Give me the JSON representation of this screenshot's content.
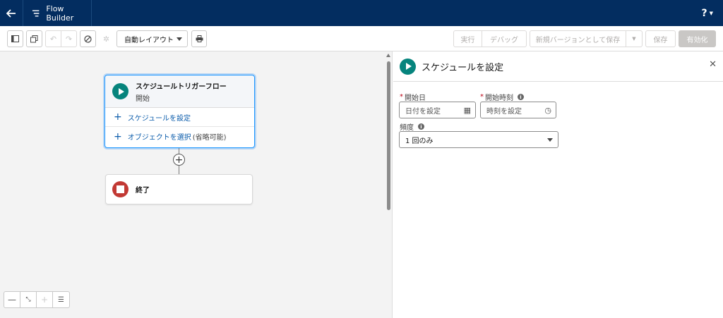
{
  "header": {
    "app_title": "Flow Builder",
    "help_label": "?"
  },
  "toolbar": {
    "layout_value": "自動レイアウト",
    "run_label": "実行",
    "debug_label": "デバッグ",
    "save_new_version_label": "新規バージョンとして保存",
    "save_label": "保存",
    "activate_label": "有効化"
  },
  "canvas": {
    "start": {
      "title": "スケジュールトリガーフロー",
      "subtitle": "開始",
      "set_schedule_label": "スケジュールを設定",
      "choose_object_label": "オブジェクトを選択",
      "optional_note": "(省略可能)"
    },
    "end_label": "終了"
  },
  "panel": {
    "title": "スケジュールを設定",
    "start_date": {
      "label": "開始日",
      "placeholder": "日付を設定"
    },
    "start_time": {
      "label": "開始時刻",
      "placeholder": "時刻を設定"
    },
    "frequency": {
      "label": "頻度",
      "value": "1 回のみ"
    }
  },
  "colors": {
    "header_bg": "#032d60",
    "start_icon": "#06847d",
    "end_icon": "#c23934",
    "link": "#0b5cab"
  }
}
